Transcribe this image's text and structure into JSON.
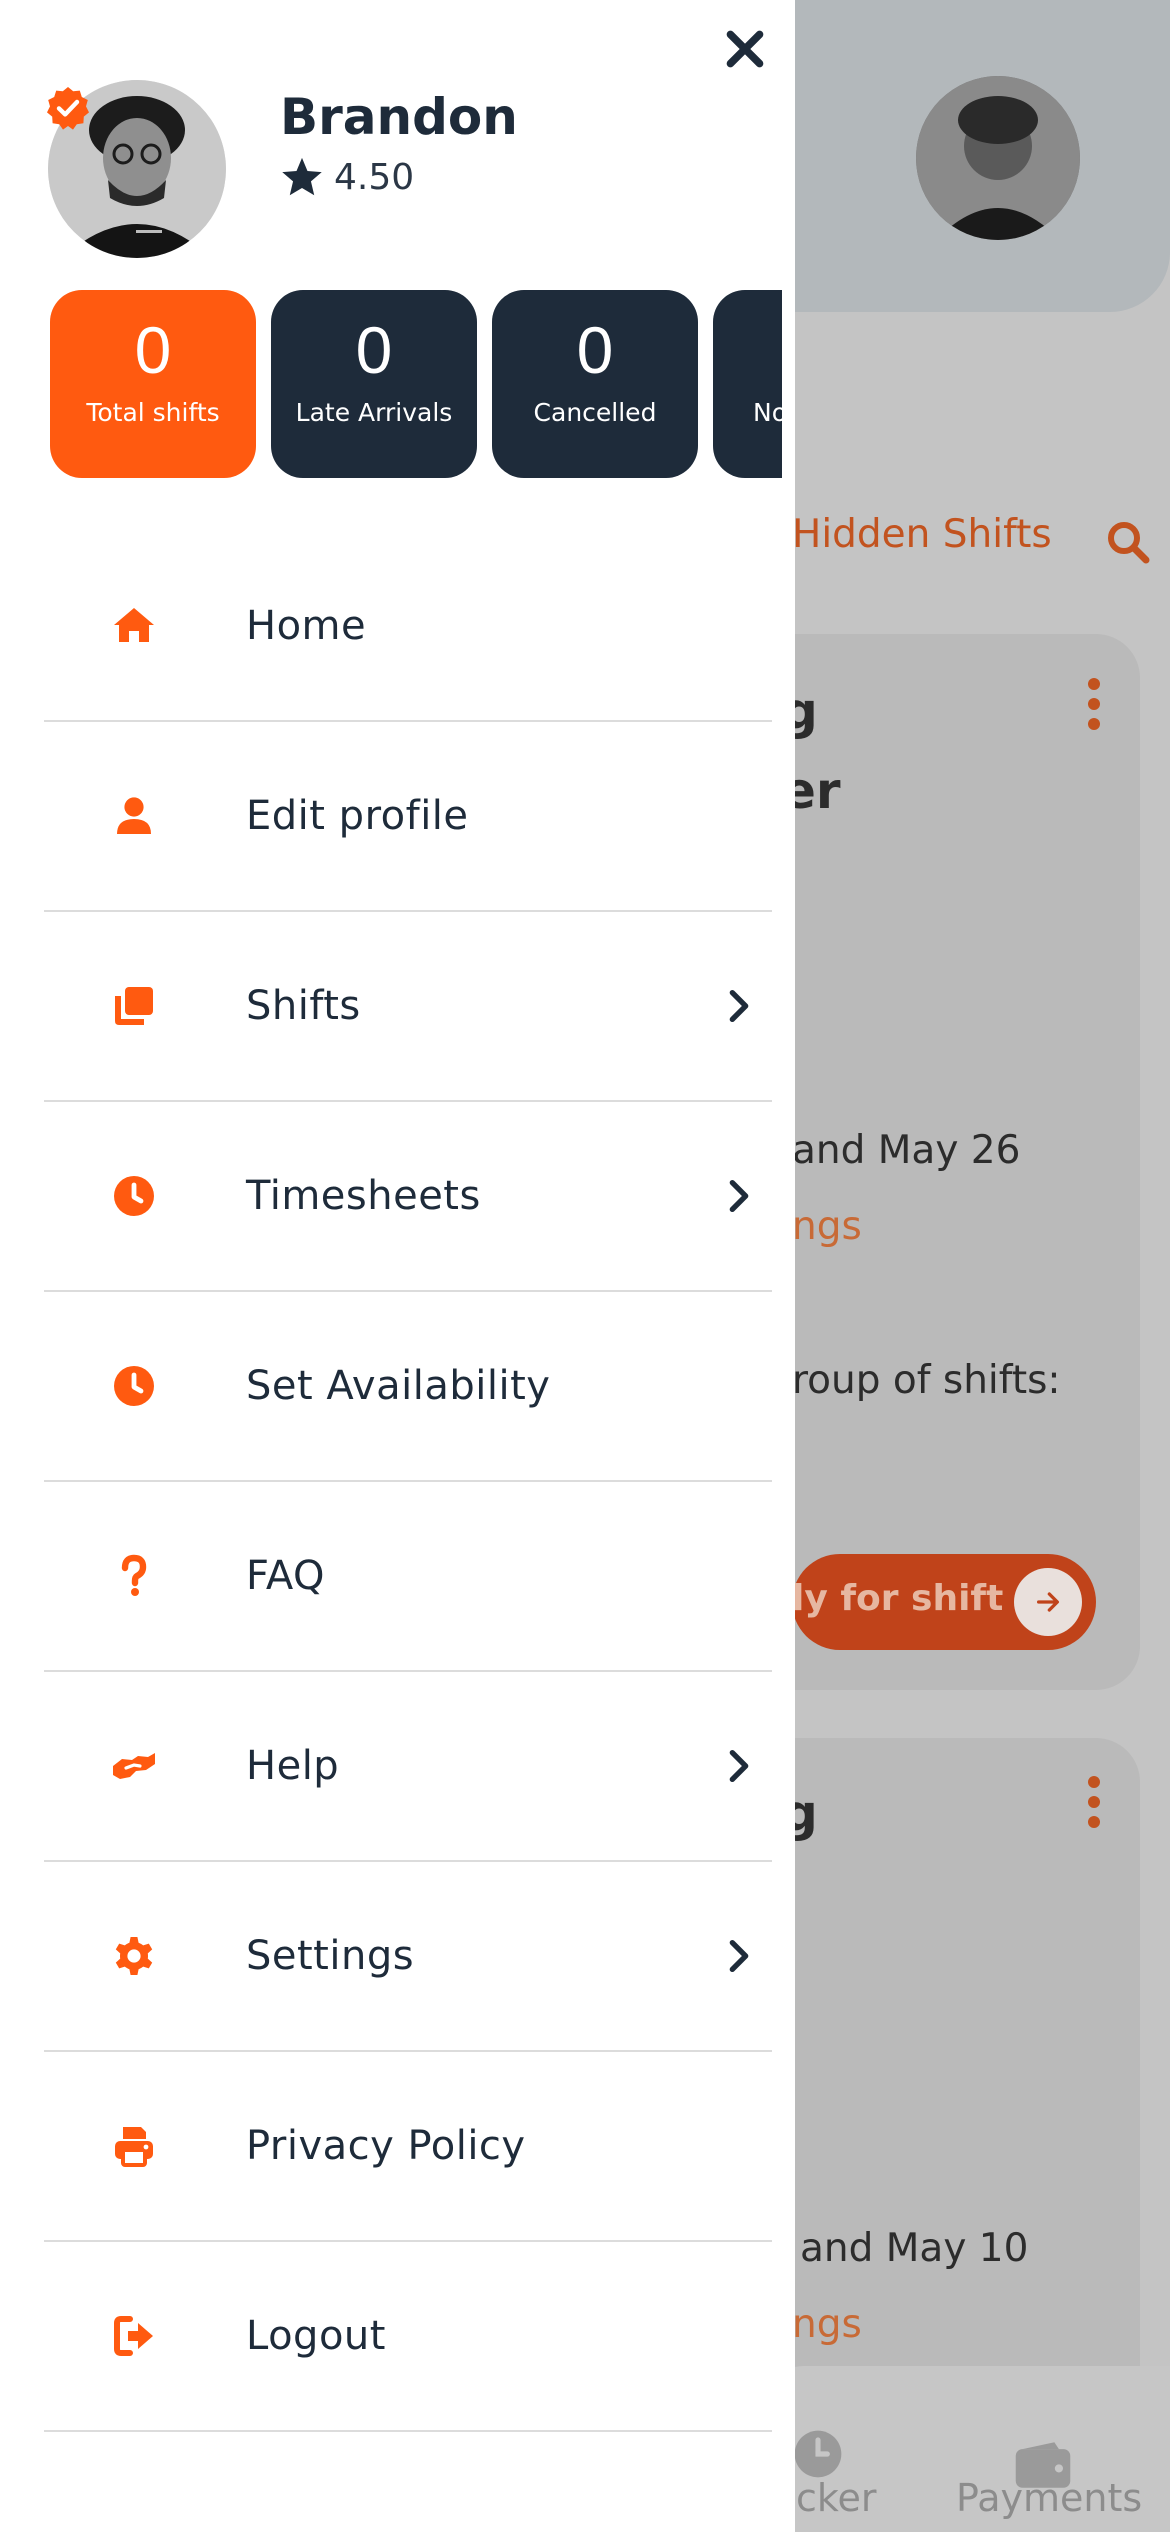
{
  "background": {
    "hidden_shifts_label": "Hidden Shifts",
    "card1": {
      "title_fragment": "g",
      "subtitle_fragment": "er",
      "date_fragment": "and May 26",
      "link_fragment": "ngs",
      "group_fragment": "roup of shifts:",
      "apply_fragment": "ly for shift"
    },
    "card2": {
      "title_fragment": "g",
      "date_fragment": "and May 10",
      "link_fragment": "ngs"
    },
    "tabbar": {
      "tab1_fragment": "cker",
      "tab2": "Payments"
    }
  },
  "profile": {
    "name": "Brandon",
    "rating": "4.50"
  },
  "stats": [
    {
      "value": "0",
      "label": "Total shifts"
    },
    {
      "value": "0",
      "label": "Late Arrivals"
    },
    {
      "value": "0",
      "label": "Cancelled"
    },
    {
      "value": "",
      "label": "No"
    }
  ],
  "menu": [
    {
      "label": "Home",
      "icon": "home-icon",
      "has_chevron": false
    },
    {
      "label": "Edit profile",
      "icon": "user-icon",
      "has_chevron": false
    },
    {
      "label": "Shifts",
      "icon": "copy-icon",
      "has_chevron": true
    },
    {
      "label": "Timesheets",
      "icon": "clock-icon",
      "has_chevron": true
    },
    {
      "label": "Set Availability",
      "icon": "clock-icon",
      "has_chevron": false
    },
    {
      "label": "FAQ",
      "icon": "question-icon",
      "has_chevron": false
    },
    {
      "label": "Help",
      "icon": "handshake-icon",
      "has_chevron": true
    },
    {
      "label": "Settings",
      "icon": "gear-icon",
      "has_chevron": true
    },
    {
      "label": "Privacy Policy",
      "icon": "printer-icon",
      "has_chevron": false
    },
    {
      "label": "Logout",
      "icon": "logout-icon",
      "has_chevron": false
    }
  ],
  "colors": {
    "accent": "#FF5A10",
    "dark": "#1E2B3A",
    "divider": "#DCDCDC"
  }
}
